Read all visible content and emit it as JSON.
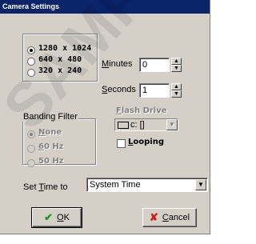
{
  "window": {
    "title": "Camera Settings"
  },
  "resolution": {
    "options": [
      {
        "label": "1280 x 1024",
        "selected": true
      },
      {
        "label": "640 x 480",
        "selected": false
      },
      {
        "label": "320 x 240",
        "selected": false
      }
    ]
  },
  "minutes": {
    "label_pre": "",
    "label_ul": "M",
    "label_post": "inutes",
    "value": "0",
    "spin_up": "▲",
    "spin_down": "▼"
  },
  "seconds": {
    "label_pre": "",
    "label_ul": "S",
    "label_post": "econds",
    "value": "1",
    "spin_up": "▲",
    "spin_down": "▼"
  },
  "banding": {
    "title": "Banding Filter",
    "options": [
      {
        "pre": "",
        "ul": "N",
        "post": "one",
        "selected": true
      },
      {
        "pre": "",
        "ul": "6",
        "post": "0 Hz",
        "selected": false
      },
      {
        "pre": "",
        "ul": "5",
        "post": "0 Hz",
        "selected": false
      }
    ]
  },
  "flash_drive": {
    "label_pre": "",
    "label_ul": "F",
    "label_post": "lash Drive",
    "value": "c: []",
    "arrow": "▼"
  },
  "looping": {
    "label_pre": "",
    "label_ul": "L",
    "label_post": "ooping",
    "checked": false
  },
  "set_time": {
    "label_pre": "Set ",
    "label_ul": "T",
    "label_post": "ime to",
    "value": "System Time",
    "arrow": "▼"
  },
  "buttons": {
    "ok": {
      "pre": "",
      "ul": "O",
      "post": "K",
      "icon": "✔",
      "icon_color": "#1c9c1c"
    },
    "cancel": {
      "pre": "",
      "ul": "C",
      "post": "ancel",
      "icon": "✘",
      "icon_color": "#cc1c1c"
    }
  },
  "watermark": "SAMPLE"
}
